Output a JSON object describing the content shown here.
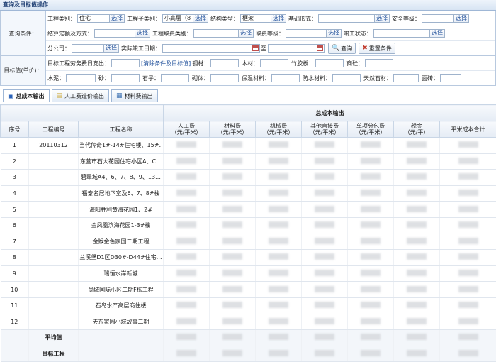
{
  "panel_title": "查询及目标值操作",
  "query": {
    "label": "查询条件：",
    "select_label": "选择",
    "row1": [
      {
        "label": "工程类别：",
        "value": "住宅"
      },
      {
        "label": "工程子类别：",
        "value": "小高层（8"
      },
      {
        "label": "结构类型：",
        "value": "框架"
      },
      {
        "label": "基础形式：",
        "value": ""
      },
      {
        "label": "安全等级：",
        "value": ""
      }
    ],
    "row2": [
      {
        "label": "结算定额及方式：",
        "value": ""
      },
      {
        "label": "工程取费类别：",
        "value": ""
      },
      {
        "label": "取费等级：",
        "value": ""
      },
      {
        "label": "竣工状态：",
        "value": ""
      }
    ],
    "branch_label": "分公司：",
    "branch_value": "",
    "date_label": "实际竣工日期：",
    "date_to": "至",
    "search_btn": "查询",
    "reset_btn": "重置条件"
  },
  "target": {
    "label": "目标值(单价)：",
    "labor_label": "目标工程劳务费日支出：",
    "clear_link": "[清除条件及目标值]",
    "row1": [
      "钢材：",
      "木材：",
      "竹胶板：",
      "商砼："
    ],
    "row2": [
      "水泥：",
      "砂：",
      "石子：",
      "砌体：",
      "保温材料：",
      "防水材料：",
      "天然石材：",
      "面砖："
    ]
  },
  "tabs": [
    {
      "label": "总成本输出",
      "icon": "output-icon"
    },
    {
      "label": "人工费造价输出",
      "icon": "document-icon"
    },
    {
      "label": "材料费输出",
      "icon": "table-icon"
    }
  ],
  "grid": {
    "group_header": "总成本输出",
    "columns": [
      "序号",
      "工程编号",
      "工程名称",
      "人工费\n（元/平米）",
      "材料费\n（元/平米）",
      "机械费\n（元/平米）",
      "其他直接费\n（元/平米）",
      "单项分包费\n（元/平米）",
      "税金\n（元/平）",
      "平米成本合计"
    ],
    "rows": [
      {
        "no": "1",
        "code": "20110312",
        "name": "当代传奇1#-14#住宅楼、15#…"
      },
      {
        "no": "2",
        "code": "",
        "name": "东营市石大花园住宅小区A、C…"
      },
      {
        "no": "3",
        "code": "",
        "name": "碧翠城A4、6、7、8、9、13…"
      },
      {
        "no": "4",
        "code": "",
        "name": "福泰名居地下室及6、7、8#楼"
      },
      {
        "no": "5",
        "code": "",
        "name": "海阳胜利黄海花园1、2#"
      },
      {
        "no": "6",
        "code": "",
        "name": "金凤凰滨海花园1-3#楼"
      },
      {
        "no": "7",
        "code": "",
        "name": "金猴金色家园二期工程"
      },
      {
        "no": "8",
        "code": "",
        "name": "兰溪堡D1区D30#-D44#住宅…"
      },
      {
        "no": "9",
        "code": "",
        "name": "瑞恒水岸新城"
      },
      {
        "no": "10",
        "code": "",
        "name": "尚城国际小区二期F栋工程"
      },
      {
        "no": "11",
        "code": "",
        "name": "石岛水产高层商住楼"
      },
      {
        "no": "12",
        "code": "",
        "name": "天东家园小城故事二期"
      }
    ],
    "avg_label": "平均值",
    "target_label": "目标工程"
  }
}
